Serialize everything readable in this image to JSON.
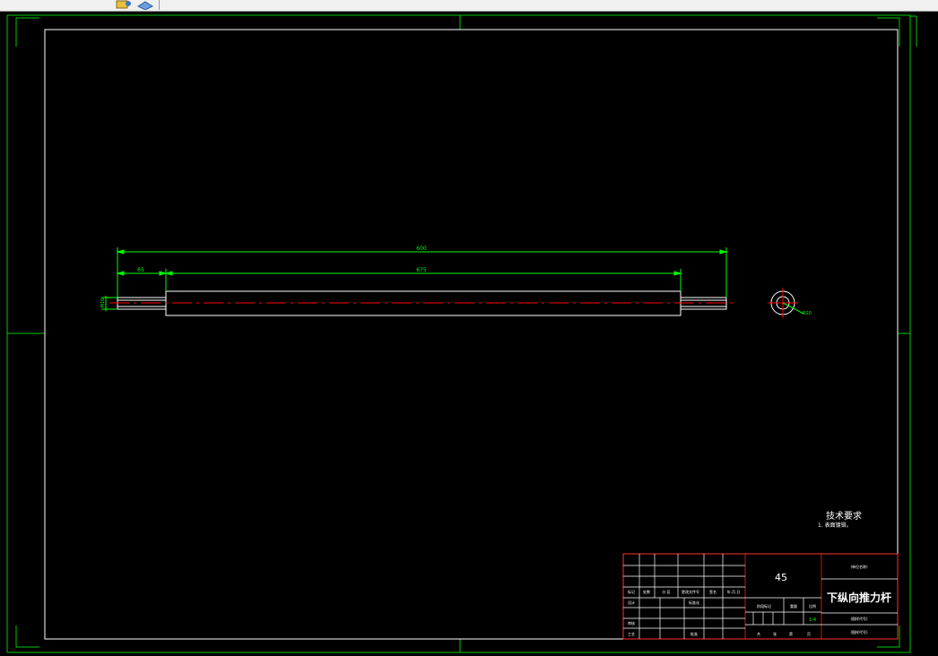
{
  "toolbar": {
    "icons": [
      "folder-tool-icon",
      "layer-tool-icon"
    ]
  },
  "drawing": {
    "dimensions": {
      "overall_length": "600",
      "left_end": "65",
      "middle_section": "675",
      "end_diameter": "M16",
      "circle_callout": "R20"
    },
    "tech_requirements": {
      "title": "技术要求",
      "item1": "1. 表面镀铬。"
    },
    "title_block": {
      "material": "45",
      "part_name": "下纵向推力杆",
      "org_label": "(单位名称)",
      "drawing_no_label": "(图样代号)",
      "drawing_no_label2": "(图样代号)",
      "scale": "1:4",
      "headers": {
        "mark": "标记",
        "count": "处数",
        "zone": "分 区",
        "change_doc": "更改文件号",
        "signature": "签名",
        "date": "年.月.日",
        "design": "设计",
        "standardize": "标准化",
        "review": "审核",
        "process": "工艺",
        "approve": "批准",
        "stage_mark": "阶段标记",
        "weight": "重量",
        "ratio": "比例",
        "total": "共",
        "sheets": "张",
        "sheet_no": "第",
        "page": "页"
      }
    }
  },
  "colors": {
    "frame": "#ffffff",
    "margin_lines": "#00c800",
    "dimension": "#00ff00",
    "centerline": "#ff0000",
    "title_block_border": "#ff3030"
  }
}
